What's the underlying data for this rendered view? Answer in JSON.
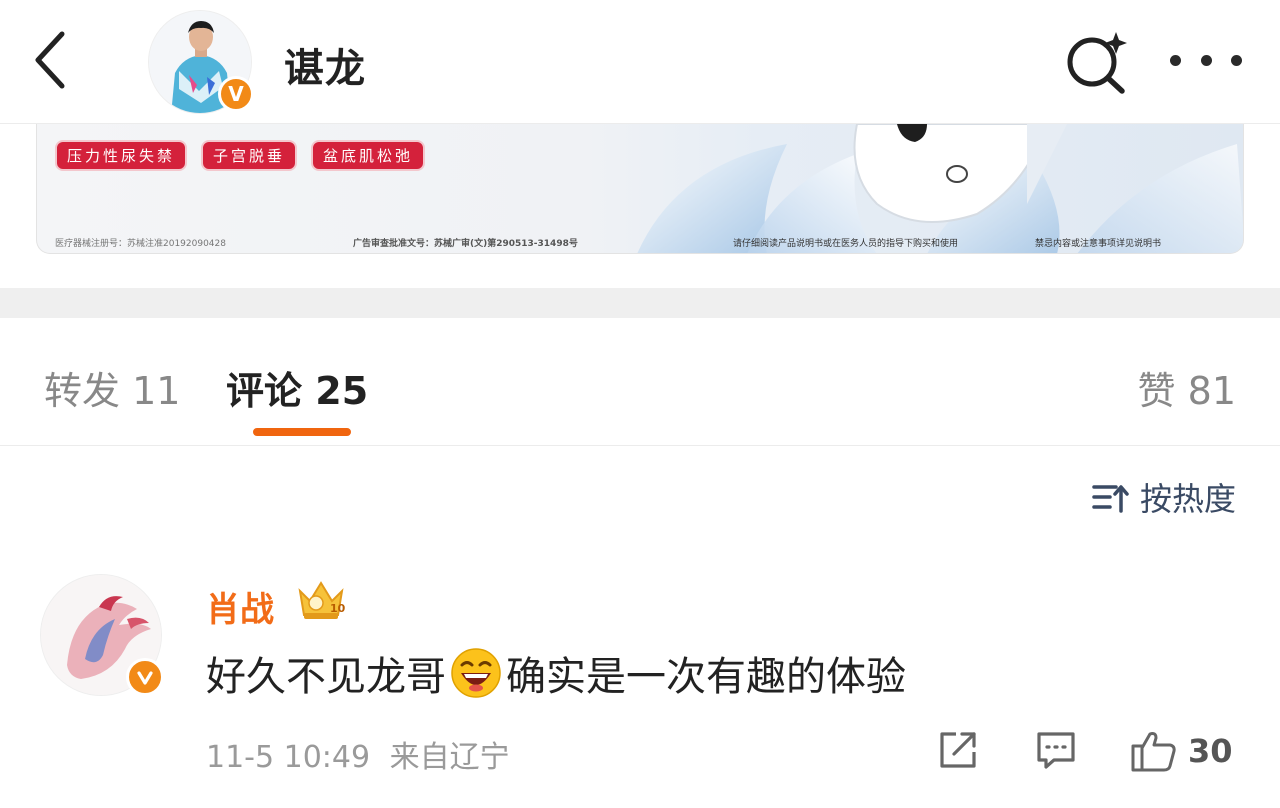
{
  "header": {
    "title": "谌龙",
    "verified_badge": "V"
  },
  "ad": {
    "tags": [
      "压力性尿失禁",
      "子宫脱垂",
      "盆底肌松弛"
    ],
    "footnotes": [
      "医疗器械注册号：苏械注准20192090428",
      "广告审查批准文号：苏械广审(文)第290513-31498号",
      "请仔细阅读产品说明书或在医务人员的指导下购买和使用",
      "禁忌内容或注意事项详见说明书"
    ]
  },
  "tabs": {
    "repost": {
      "label": "转发",
      "count": "11"
    },
    "comment": {
      "label": "评论",
      "count": "25"
    },
    "like": {
      "label": "赞",
      "count": "81"
    }
  },
  "sort": {
    "label": "按热度"
  },
  "comments": [
    {
      "author": "肖战",
      "verified_badge": "V",
      "text_before": "好久不见龙哥",
      "text_after": "确实是一次有趣的体验",
      "date": "11-5 10:49",
      "location": "来自辽宁",
      "likes": "30"
    }
  ],
  "icons": {
    "back": "chevron-left-icon",
    "search": "search-sparkle-icon",
    "more": "more-dots-icon",
    "sort": "sort-icon",
    "share": "share-icon",
    "reply": "comment-icon",
    "like": "thumbs-up-icon"
  },
  "colors": {
    "accent": "#f0650f",
    "name": "#f26c18",
    "verified": "#f28a17",
    "ad_tag": "#d4213b"
  }
}
